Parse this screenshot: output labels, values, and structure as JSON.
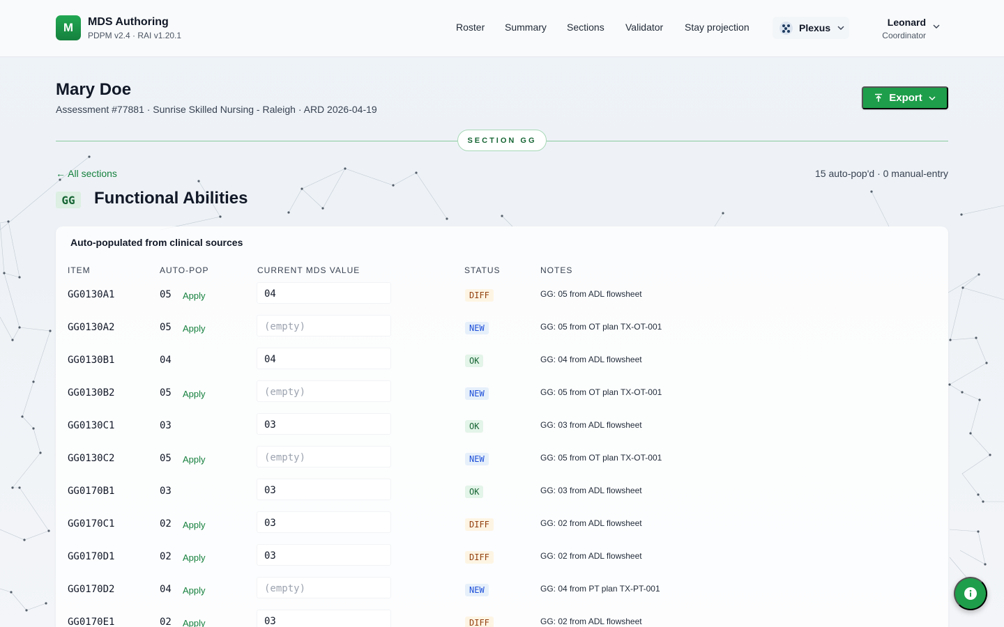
{
  "header": {
    "logo_letter": "M",
    "app_title": "MDS Authoring",
    "app_version": "PDPM v2.4 · RAI v1.20.1",
    "nav": [
      "Roster",
      "Summary",
      "Sections",
      "Validator",
      "Stay projection"
    ],
    "facility_name": "Plexus",
    "facility_icon": "network-icon",
    "user_name": "Leonard",
    "user_role": "Coordinator"
  },
  "patient": {
    "name": "Mary Doe",
    "subtitle": "Assessment #77881 · Sunrise Skilled Nursing - Raleigh · ARD 2026-04-19"
  },
  "export": {
    "label": "Export",
    "icon": "export-icon"
  },
  "section": {
    "pill": "SECTION GG",
    "back_label": "All sections",
    "counts": "15 auto-pop'd · 0 manual-entry",
    "code": "GG",
    "title": "Functional Abilities"
  },
  "table": {
    "title": "Auto-populated from clinical sources",
    "headers": [
      "ITEM",
      "AUTO-POP",
      "CURRENT MDS VALUE",
      "STATUS",
      "NOTES"
    ],
    "apply_label": "Apply",
    "rows": [
      {
        "item": "GG0130A1",
        "auto": "05",
        "apply": true,
        "value": "04",
        "status": "DIFF",
        "notes": "GG: 05 from ADL flowsheet"
      },
      {
        "item": "GG0130A2",
        "auto": "05",
        "apply": true,
        "value": "(empty)",
        "status": "NEW",
        "notes": "GG: 05 from OT plan TX-OT-001"
      },
      {
        "item": "GG0130B1",
        "auto": "04",
        "apply": false,
        "value": "04",
        "status": "OK",
        "notes": "GG: 04 from ADL flowsheet"
      },
      {
        "item": "GG0130B2",
        "auto": "05",
        "apply": true,
        "value": "(empty)",
        "status": "NEW",
        "notes": "GG: 05 from OT plan TX-OT-001"
      },
      {
        "item": "GG0130C1",
        "auto": "03",
        "apply": false,
        "value": "03",
        "status": "OK",
        "notes": "GG: 03 from ADL flowsheet"
      },
      {
        "item": "GG0130C2",
        "auto": "05",
        "apply": true,
        "value": "(empty)",
        "status": "NEW",
        "notes": "GG: 05 from OT plan TX-OT-001"
      },
      {
        "item": "GG0170B1",
        "auto": "03",
        "apply": false,
        "value": "03",
        "status": "OK",
        "notes": "GG: 03 from ADL flowsheet"
      },
      {
        "item": "GG0170C1",
        "auto": "02",
        "apply": true,
        "value": "03",
        "status": "DIFF",
        "notes": "GG: 02 from ADL flowsheet"
      },
      {
        "item": "GG0170D1",
        "auto": "02",
        "apply": true,
        "value": "03",
        "status": "DIFF",
        "notes": "GG: 02 from ADL flowsheet"
      },
      {
        "item": "GG0170D2",
        "auto": "04",
        "apply": true,
        "value": "(empty)",
        "status": "NEW",
        "notes": "GG: 04 from PT plan TX-PT-001"
      },
      {
        "item": "GG0170E1",
        "auto": "02",
        "apply": true,
        "value": "03",
        "status": "DIFF",
        "notes": "GG: 02 from ADL flowsheet"
      }
    ]
  },
  "fab": {
    "icon": "info-icon"
  },
  "colors": {
    "accent": "#1e9e4a",
    "diff": "#92400e",
    "new": "#1d4ed8",
    "ok": "#166534"
  }
}
